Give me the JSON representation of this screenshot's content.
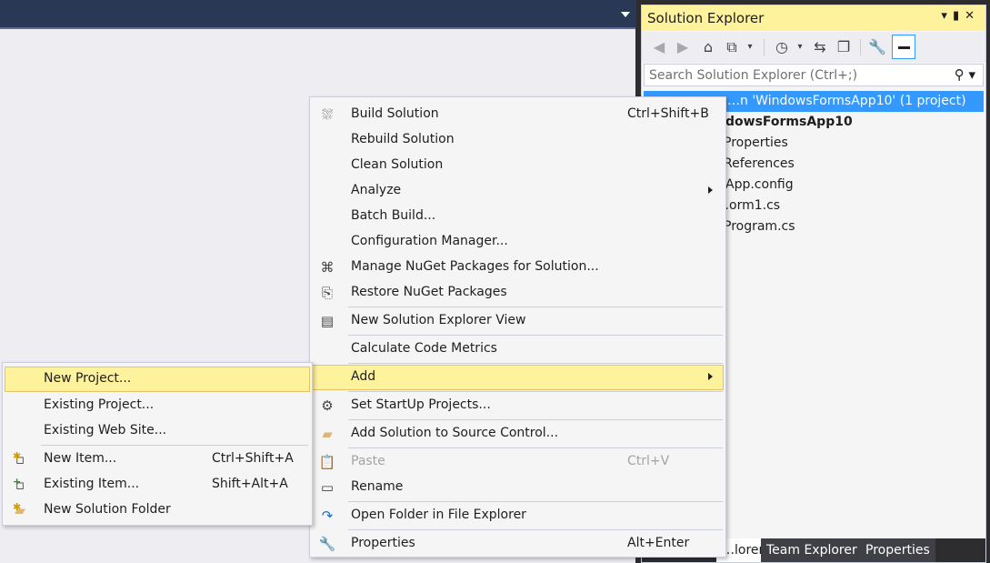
{
  "solution_explorer": {
    "title": "Solution Explorer",
    "title_controls": "▾ 🖈 ✕",
    "search_placeholder": "Search Solution Explorer (Ctrl+;)",
    "tree": [
      {
        "label": "…n 'WindowsFormsApp10' (1 project)",
        "selected": true
      },
      {
        "label": "…dowsFormsApp10",
        "bold": true
      },
      {
        "label": "Properties"
      },
      {
        "label": "References"
      },
      {
        "label": "App.config"
      },
      {
        "label": "…orm1.cs"
      },
      {
        "label": "Program.cs"
      }
    ],
    "bottom_tabs": [
      "…lorer",
      "Team Explorer",
      "Properties"
    ]
  },
  "context_menu": {
    "items": [
      {
        "label": "Build Solution",
        "shortcut": "Ctrl+Shift+B",
        "icon": "build-icon"
      },
      {
        "label": "Rebuild Solution"
      },
      {
        "label": "Clean Solution"
      },
      {
        "label": "Analyze",
        "submenu": true
      },
      {
        "label": "Batch Build..."
      },
      {
        "label": "Configuration Manager..."
      },
      {
        "label": "Manage NuGet Packages for Solution...",
        "icon": "nuget-icon"
      },
      {
        "label": "Restore NuGet Packages",
        "icon": "restore-icon"
      },
      {
        "label": "New Solution Explorer View",
        "icon": "new-view-icon"
      },
      {
        "label": "Calculate Code Metrics"
      },
      {
        "label": "Add",
        "submenu": true,
        "highlighted": true
      },
      {
        "label": "Set StartUp Projects...",
        "icon": "gear-icon"
      },
      {
        "label": "Add Solution to Source Control...",
        "icon": "source-control-icon"
      },
      {
        "label": "Paste",
        "shortcut": "Ctrl+V",
        "disabled": true,
        "icon": "paste-icon"
      },
      {
        "label": "Rename",
        "icon": "rename-icon"
      },
      {
        "label": "Open Folder in File Explorer",
        "icon": "refresh-arrow-icon"
      },
      {
        "label": "Properties",
        "shortcut": "Alt+Enter",
        "icon": "wrench-icon"
      }
    ]
  },
  "add_submenu": {
    "items": [
      {
        "label": "New Project...",
        "highlighted": true
      },
      {
        "label": "Existing Project..."
      },
      {
        "label": "Existing Web Site..."
      },
      {
        "label": "New Item...",
        "shortcut": "Ctrl+Shift+A",
        "icon": "new-item-icon"
      },
      {
        "label": "Existing Item...",
        "shortcut": "Shift+Alt+A",
        "icon": "existing-item-icon"
      },
      {
        "label": "New Solution Folder",
        "icon": "new-folder-icon"
      }
    ]
  },
  "colors": {
    "highlight": "#fff29d",
    "selection": "#3399ff",
    "menu_bg": "#f5f5f5",
    "ide_dark": "#2d2d30"
  }
}
